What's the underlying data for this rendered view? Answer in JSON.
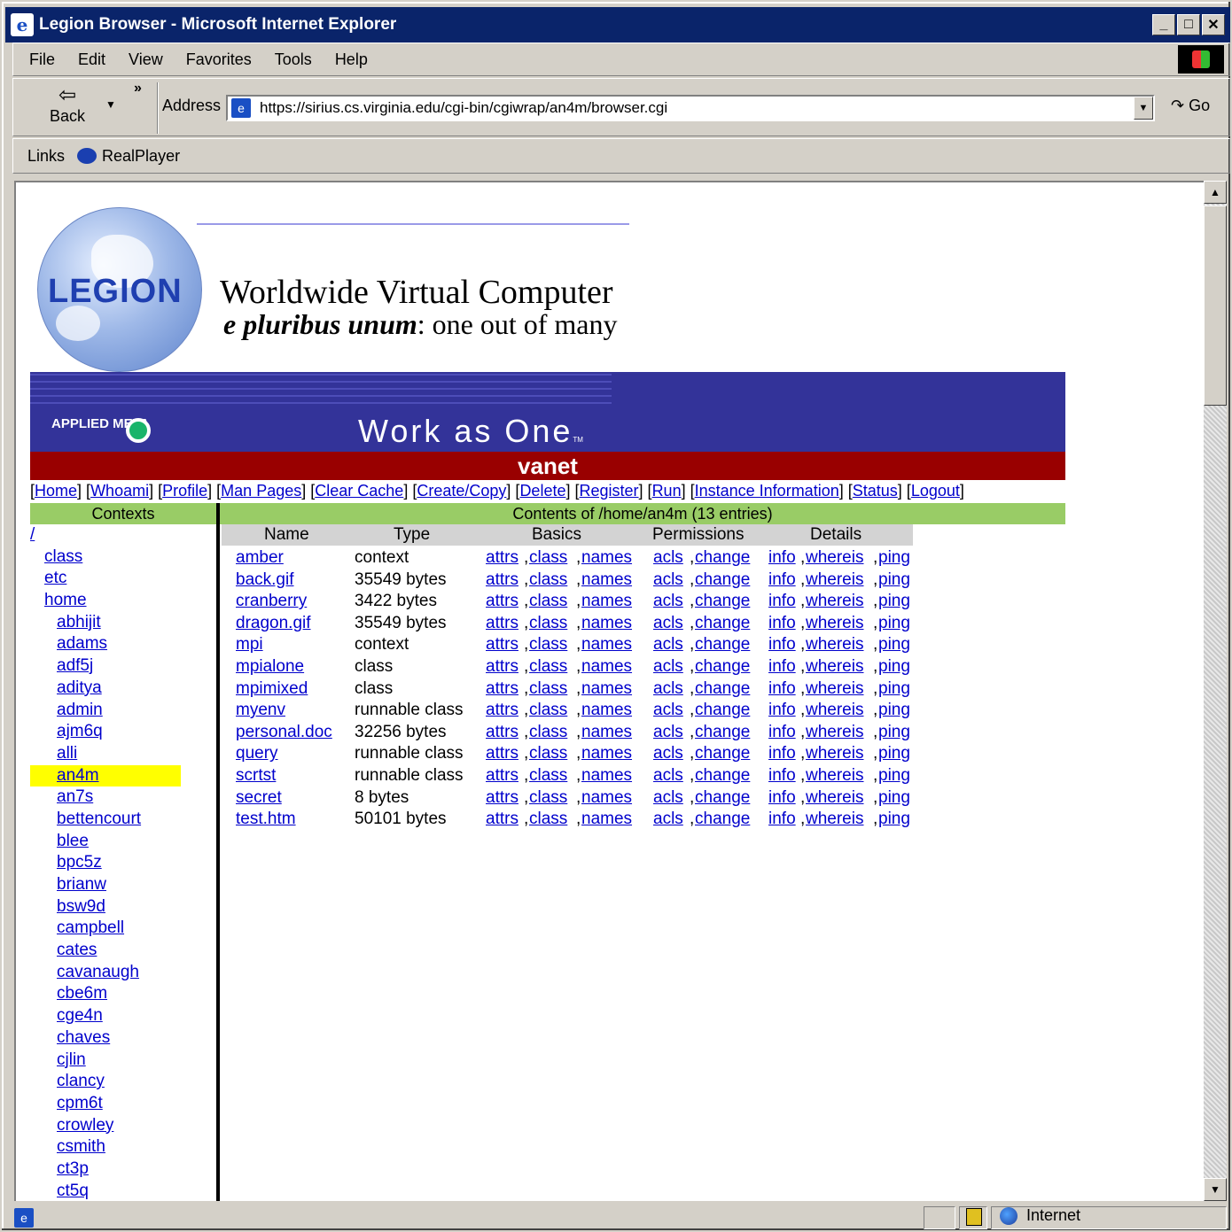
{
  "window": {
    "title": "Legion Browser - Microsoft Internet Explorer"
  },
  "menu": [
    "File",
    "Edit",
    "View",
    "Favorites",
    "Tools",
    "Help"
  ],
  "toolbar": {
    "back_label": "Back",
    "address_label": "Address",
    "url": "https://sirius.cs.virginia.edu/cgi-bin/cgiwrap/an4m/browser.cgi",
    "go_label": "Go"
  },
  "links_bar": {
    "label": "Links",
    "items": [
      "RealPlayer"
    ]
  },
  "status": {
    "zone": "Internet"
  },
  "page": {
    "logo_text": "LEGION",
    "heading": "Worldwide Virtual Computer",
    "motto_italic": "e pluribus unum",
    "motto_rest": ": one out of many",
    "brand": "APPLIED META",
    "slogan": "Work as One",
    "tm": "TM",
    "banner": "vanet",
    "nav": [
      "Home",
      "Whoami",
      "Profile",
      "Man Pages",
      "Clear Cache",
      "Create/Copy",
      "Delete",
      "Register",
      "Run",
      "Instance Information",
      "Status",
      "Logout"
    ],
    "contexts_header": "Contexts",
    "contents_header": "Contents of /home/an4m (13 entries)",
    "contexts": [
      {
        "label": "/",
        "level": 0
      },
      {
        "label": "class",
        "level": 1
      },
      {
        "label": "etc",
        "level": 1
      },
      {
        "label": "home",
        "level": 1
      },
      {
        "label": "abhijit",
        "level": 2
      },
      {
        "label": "adams",
        "level": 2
      },
      {
        "label": "adf5j",
        "level": 2
      },
      {
        "label": "aditya",
        "level": 2
      },
      {
        "label": "admin",
        "level": 2
      },
      {
        "label": "ajm6q",
        "level": 2
      },
      {
        "label": "alli",
        "level": 2
      },
      {
        "label": "an4m",
        "level": 2,
        "selected": true
      },
      {
        "label": "an7s",
        "level": 2
      },
      {
        "label": "bettencourt",
        "level": 2
      },
      {
        "label": "blee",
        "level": 2
      },
      {
        "label": "bpc5z",
        "level": 2
      },
      {
        "label": "brianw",
        "level": 2
      },
      {
        "label": "bsw9d",
        "level": 2
      },
      {
        "label": "campbell",
        "level": 2
      },
      {
        "label": "cates",
        "level": 2
      },
      {
        "label": "cavanaugh",
        "level": 2
      },
      {
        "label": "cbe6m",
        "level": 2
      },
      {
        "label": "cge4n",
        "level": 2
      },
      {
        "label": "chaves",
        "level": 2
      },
      {
        "label": "cjlin",
        "level": 2
      },
      {
        "label": "clancy",
        "level": 2
      },
      {
        "label": "cpm6t",
        "level": 2
      },
      {
        "label": "crowley",
        "level": 2
      },
      {
        "label": "csmith",
        "level": 2
      },
      {
        "label": "ct3p",
        "level": 2
      },
      {
        "label": "ct5q",
        "level": 2
      }
    ],
    "columns": [
      "Name",
      "Type",
      "Basics",
      "Permissions",
      "Details"
    ],
    "basics_links": [
      "attrs",
      "class",
      "names"
    ],
    "permissions_links": [
      "acls",
      "change"
    ],
    "details_links": [
      "info",
      "whereis",
      "ping"
    ],
    "entries": [
      {
        "name": "amber",
        "type": "context"
      },
      {
        "name": "back.gif",
        "type": "35549 bytes"
      },
      {
        "name": "cranberry",
        "type": "3422 bytes"
      },
      {
        "name": "dragon.gif",
        "type": "35549 bytes"
      },
      {
        "name": "mpi",
        "type": "context"
      },
      {
        "name": "mpialone",
        "type": "class"
      },
      {
        "name": "mpimixed",
        "type": "class"
      },
      {
        "name": "myenv",
        "type": "runnable class"
      },
      {
        "name": "personal.doc",
        "type": "32256 bytes"
      },
      {
        "name": "query",
        "type": "runnable class"
      },
      {
        "name": "scrtst",
        "type": "runnable class"
      },
      {
        "name": "secret",
        "type": "8 bytes"
      },
      {
        "name": "test.htm",
        "type": "50101 bytes"
      }
    ]
  }
}
